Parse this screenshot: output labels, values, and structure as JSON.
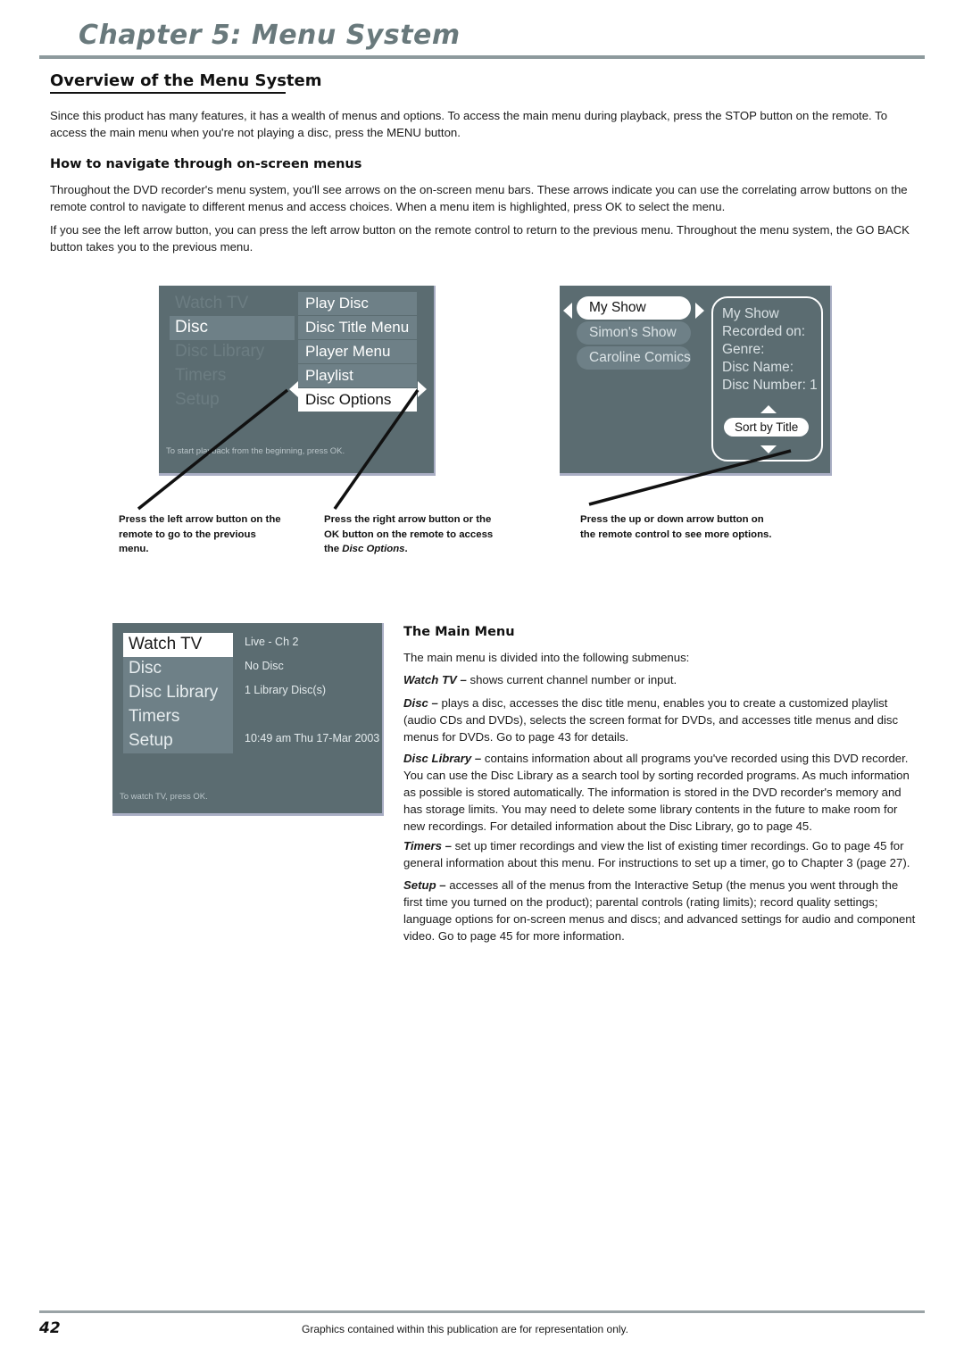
{
  "header": {
    "chapter_title": "Chapter 5: Menu System",
    "section_title": "Overview of the Menu System"
  },
  "intro": {
    "paragraph": "Since this product has many features, it has a wealth of menus and options. To access the main menu during playback, press the STOP button on the remote. To access the main menu when you're not playing a disc, press the MENU button."
  },
  "navigate": {
    "heading": "How to navigate through on-screen menus",
    "paragraph1": "Throughout the DVD recorder's menu system, you'll see arrows on the on-screen menu bars. These arrows indicate you can use the correlating arrow buttons on the remote control to navigate to different menus and access choices. When a menu item is highlighted, press OK to select the menu.",
    "paragraph2": "If you see the left arrow button, you can press the left arrow button on the remote control to return to the previous menu. Throughout the menu system, the GO BACK button takes you to the previous menu."
  },
  "disc_menu_shot": {
    "main_items": [
      {
        "label": "Watch TV",
        "state": "dim"
      },
      {
        "label": "Disc",
        "state": "selected"
      },
      {
        "label": "Disc Library",
        "state": "dim"
      },
      {
        "label": "Timers",
        "state": "dim"
      },
      {
        "label": "Setup",
        "state": "dim"
      }
    ],
    "sub_items": [
      {
        "label": "Play Disc",
        "state": "normal"
      },
      {
        "label": "Disc Title Menu",
        "state": "normal"
      },
      {
        "label": "Player Menu",
        "state": "normal"
      },
      {
        "label": "Playlist",
        "state": "normal"
      },
      {
        "label": "Disc Options",
        "state": "active"
      }
    ],
    "hint": "To start playback from the beginning, press OK.",
    "left_arrow_icon": "triangle-left-icon",
    "right_arrow_icon": "triangle-right-icon"
  },
  "library_shot": {
    "left_arrow_icon": "triangle-left-icon",
    "right_arrow_icon": "triangle-right-icon",
    "up_arrow_icon": "triangle-up-icon",
    "down_arrow_icon": "triangle-down-icon",
    "shows": [
      {
        "label": "My Show",
        "state": "selected"
      },
      {
        "label": "Simon's Show",
        "state": "normal"
      },
      {
        "label": "Caroline Comics",
        "state": "normal"
      }
    ],
    "info": [
      "My Show",
      "Recorded on:",
      "Genre:",
      "Disc Name:",
      "Disc Number: 1"
    ],
    "sort_button": "Sort by Title"
  },
  "captions": {
    "left": "Press the left arrow button on the remote to go to the previous menu.",
    "middle_part1": "Press the right arrow button or the OK button on the remote to access the ",
    "middle_italic": "Disc Options",
    "middle_part2": ".",
    "right": "Press the up or down arrow button on the remote control to see more options."
  },
  "main_menu_shot": {
    "items": [
      {
        "label": "Watch TV",
        "state": "selected-white",
        "status": "Live - Ch 2"
      },
      {
        "label": "Disc",
        "state": "normal",
        "status": "No Disc"
      },
      {
        "label": "Disc Library",
        "state": "normal",
        "status": "1 Library Disc(s)"
      },
      {
        "label": "Timers",
        "state": "normal",
        "status": ""
      },
      {
        "label": "Setup",
        "state": "normal",
        "status": "10:49 am Thu 17-Mar 2003"
      }
    ],
    "hint": "To watch TV, press OK."
  },
  "main_menu_text": {
    "heading": "The Main Menu",
    "intro": "The main menu is divided into the following submenus:",
    "entries": [
      {
        "term": "Watch TV –",
        "body": " shows current channel number or input."
      },
      {
        "term": "Disc –",
        "body": " plays a disc, accesses the disc title menu, enables you to create a customized playlist (audio CDs and DVDs), selects the screen format for DVDs, and accesses title menus and disc menus for DVDs. Go to page 43 for details."
      },
      {
        "term": "Disc Library –",
        "body": " contains information about all programs you've recorded using this DVD recorder. You can use the Disc Library as a search tool by sorting recorded programs. As much information as possible is stored automatically. The information is stored in the DVD recorder's memory and has storage limits. You may need to delete some library contents in the future to make room for new recordings. For detailed information about the Disc Library, go to page 45."
      },
      {
        "term": "Timers –",
        "body": " set up timer recordings and view the list of existing timer recordings. Go to page 45 for general information about this menu. For instructions to set up a timer, go to Chapter 3 (page 27)."
      },
      {
        "term": "Setup –",
        "body": " accesses all of the menus from the Interactive Setup (the menus you went through the first time you turned on the product); parental controls (rating limits); record quality settings; language options for on-screen menus and discs; and advanced settings for audio and component video. Go to page 45 for more information."
      }
    ]
  },
  "footer": {
    "page_number": "42",
    "note": "Graphics contained within this publication are for representation only."
  },
  "colors": {
    "chapter_title": "#69797c",
    "screen_bg": "#5b6c71",
    "screen_item": "#6e8087",
    "screen_selected": "#ffffff"
  }
}
